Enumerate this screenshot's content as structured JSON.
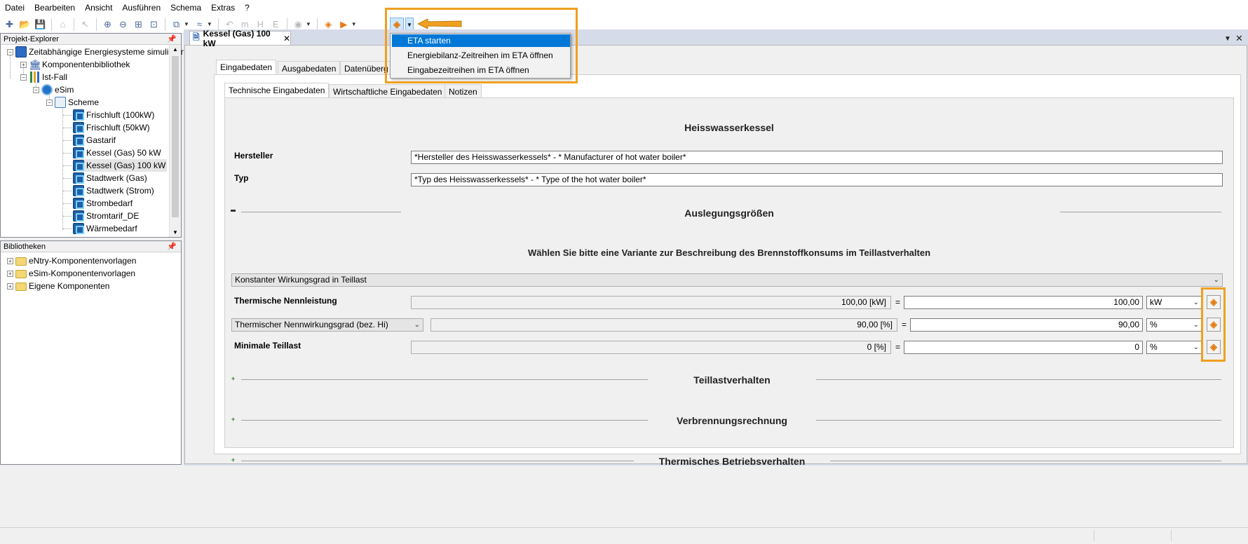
{
  "menubar": {
    "items": [
      "Datei",
      "Bearbeiten",
      "Ansicht",
      "Ausführen",
      "Schema",
      "Extras",
      "?"
    ]
  },
  "explorer": {
    "title": "Projekt-Explorer",
    "root": "Zeitabhängige Energiesysteme simulieren",
    "library": "Komponentenbibliothek",
    "case": "Ist-Fall",
    "esim": "eSim",
    "scheme": "Scheme",
    "components": [
      "Frischluft (100kW)",
      "Frischluft (50kW)",
      "Gastarif",
      "Kessel (Gas) 50 kW",
      "Kessel (Gas) 100 kW",
      "Stadtwerk (Gas)",
      "Stadtwerk (Strom)",
      "Strombedarf",
      "Stromtarif_DE",
      "Wärmebedarf"
    ]
  },
  "libraries": {
    "title": "Bibliotheken",
    "items": [
      "eNtry-Komponentenvorlagen",
      "eSim-Komponentenvorlagen",
      "Eigene Komponenten"
    ]
  },
  "document": {
    "tab_title": "Kessel (Gas) 100 kW",
    "main_tabs": [
      "Eingabedaten",
      "Ausgabedaten",
      "Datenüberg"
    ],
    "sub_tabs": [
      "Technische Eingabedaten",
      "Wirtschaftliche Eingabedaten",
      "Notizen"
    ]
  },
  "popup_menu": {
    "items": [
      "ETA starten",
      "Energiebilanz-Zeitreihen im ETA öffnen",
      "Eingabezeitreihen im ETA öffnen"
    ],
    "selected_index": 0
  },
  "form": {
    "heading": "Heisswasserkessel",
    "hersteller_label": "Hersteller",
    "hersteller_value": "*Hersteller des Heisswasserkessels* -  * Manufacturer of hot water boiler*",
    "typ_label": "Typ",
    "typ_value": "*Typ des Heisswasserkessels* - * Type of the hot water boiler*",
    "section_auslegung": "Auslegungsgrößen",
    "variant_prompt": "Wählen Sie bitte eine Variante zur Beschreibung des Brennstoffkonsums im Teillastverhalten",
    "variant_selected": "Konstanter Wirkungsgrad in Teillast",
    "rows": [
      {
        "label": "Thermische Nennleistung",
        "computed": "100,00 [kW]",
        "value": "100,00",
        "unit": "kW"
      },
      {
        "label": "Thermischer Nennwirkungsgrad (bez. Hi)",
        "computed": "90,00 [%]",
        "value": "90,00",
        "unit": "%"
      },
      {
        "label": "Minimale Teillast",
        "computed": "0 [%]",
        "value": "0",
        "unit": "%"
      }
    ],
    "equals": "=",
    "section_teillast": "Teillastverhalten",
    "section_verbrennung": "Verbrennungsrechnung",
    "section_thermisch": "Thermisches Betriebsverhalten"
  },
  "colors": {
    "highlight": "#f0a020",
    "selection": "#0078d7"
  }
}
